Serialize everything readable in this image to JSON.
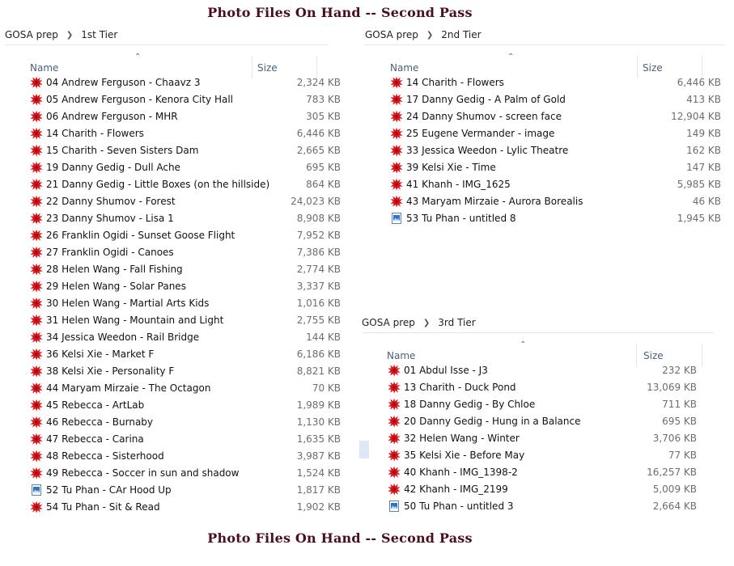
{
  "title": "Photo Files On Hand  --  Second Pass",
  "columns": {
    "name": "Name",
    "size": "Size"
  },
  "panels": [
    {
      "crumbs": [
        "GOSA prep",
        "1st Tier"
      ],
      "files": [
        {
          "name": "04 Andrew Ferguson - Chaavz 3",
          "size": "2,324 KB",
          "icon": "red-splat"
        },
        {
          "name": "05 Andrew Ferguson - Kenora City Hall",
          "size": "783 KB",
          "icon": "red-splat"
        },
        {
          "name": "06 Andrew Ferguson - MHR",
          "size": "305 KB",
          "icon": "red-splat"
        },
        {
          "name": "14 Charith - Flowers",
          "size": "6,446 KB",
          "icon": "red-splat"
        },
        {
          "name": "15 Charith - Seven Sisters Dam",
          "size": "2,665 KB",
          "icon": "red-splat"
        },
        {
          "name": "19 Danny Gedig - Dull Ache",
          "size": "695 KB",
          "icon": "red-splat"
        },
        {
          "name": "21 Danny Gedig - Little Boxes (on the hillside)",
          "size": "864 KB",
          "icon": "red-splat"
        },
        {
          "name": "22 Danny Shumov - Forest",
          "size": "24,023 KB",
          "icon": "red-splat"
        },
        {
          "name": "23 Danny Shumov - Lisa 1",
          "size": "8,908 KB",
          "icon": "red-splat"
        },
        {
          "name": "26 Franklin Ogidi - Sunset Goose Flight",
          "size": "7,952 KB",
          "icon": "red-splat"
        },
        {
          "name": "27 Franklin Ogidi - Canoes",
          "size": "7,386 KB",
          "icon": "red-splat"
        },
        {
          "name": "28 Helen Wang - Fall Fishing",
          "size": "2,774 KB",
          "icon": "red-splat"
        },
        {
          "name": "29 Helen Wang - Solar Panes",
          "size": "3,337 KB",
          "icon": "red-splat"
        },
        {
          "name": "30 Helen Wang - Martial Arts Kids",
          "size": "1,016 KB",
          "icon": "red-splat"
        },
        {
          "name": "31 Helen Wang - Mountain and Light",
          "size": "2,755 KB",
          "icon": "red-splat"
        },
        {
          "name": "34 Jessica Weedon - Rail Bridge",
          "size": "144 KB",
          "icon": "red-splat"
        },
        {
          "name": "36 Kelsi Xie - Market F",
          "size": "6,186 KB",
          "icon": "red-splat"
        },
        {
          "name": "38 Kelsi Xie - Personality F",
          "size": "8,821 KB",
          "icon": "red-splat"
        },
        {
          "name": "44 Maryam Mirzaie - The Octagon",
          "size": "70 KB",
          "icon": "red-splat"
        },
        {
          "name": "45 Rebecca - ArtLab",
          "size": "1,989 KB",
          "icon": "red-splat"
        },
        {
          "name": "46 Rebecca - Burnaby",
          "size": "1,130 KB",
          "icon": "red-splat"
        },
        {
          "name": "47 Rebecca - Carina",
          "size": "1,635 KB",
          "icon": "red-splat"
        },
        {
          "name": "48 Rebecca - Sisterhood",
          "size": "3,987 KB",
          "icon": "red-splat"
        },
        {
          "name": "49 Rebecca - Soccer in sun and shadow",
          "size": "1,524 KB",
          "icon": "red-splat"
        },
        {
          "name": "52 Tu Phan - CAr Hood Up",
          "size": "1,817 KB",
          "icon": "image-file"
        },
        {
          "name": "54 Tu Phan - Sit & Read",
          "size": "1,902 KB",
          "icon": "red-splat"
        }
      ]
    },
    {
      "crumbs": [
        "GOSA prep",
        "2nd Tier"
      ],
      "files": [
        {
          "name": "14 Charith - Flowers",
          "size": "6,446 KB",
          "icon": "red-splat"
        },
        {
          "name": "17 Danny Gedig - A Palm of Gold",
          "size": "413 KB",
          "icon": "red-splat"
        },
        {
          "name": "24 Danny Shumov - screen face",
          "size": "12,904 KB",
          "icon": "red-splat"
        },
        {
          "name": "25 Eugene Vermander - image",
          "size": "149 KB",
          "icon": "red-splat"
        },
        {
          "name": "33 Jessica Weedon - Lylic Theatre",
          "size": "162 KB",
          "icon": "red-splat"
        },
        {
          "name": "39 Kelsi Xie - Time",
          "size": "147 KB",
          "icon": "red-splat"
        },
        {
          "name": "41 Khanh - IMG_1625",
          "size": "5,985 KB",
          "icon": "red-splat"
        },
        {
          "name": "43 Maryam Mirzaie - Aurora Borealis",
          "size": "46 KB",
          "icon": "red-splat"
        },
        {
          "name": "53 Tu Phan - untitled 8",
          "size": "1,945 KB",
          "icon": "image-file"
        }
      ]
    },
    {
      "crumbs": [
        "GOSA prep",
        "3rd Tier"
      ],
      "files": [
        {
          "name": "01 Abdul Isse - J3",
          "size": "232 KB",
          "icon": "red-splat"
        },
        {
          "name": "13 Charith - Duck Pond",
          "size": "13,069 KB",
          "icon": "red-splat"
        },
        {
          "name": "18 Danny Gedig - By Chloe",
          "size": "711 KB",
          "icon": "red-splat"
        },
        {
          "name": "20 Danny Gedig - Hung in a Balance",
          "size": "695 KB",
          "icon": "red-splat"
        },
        {
          "name": "32 Helen Wang - Winter",
          "size": "3,706 KB",
          "icon": "red-splat"
        },
        {
          "name": "35 Kelsi Xie - Before May",
          "size": "77 KB",
          "icon": "red-splat"
        },
        {
          "name": "40 Khanh - IMG_1398-2",
          "size": "16,257 KB",
          "icon": "red-splat"
        },
        {
          "name": "42 Khanh - IMG_2199",
          "size": "5,009 KB",
          "icon": "red-splat"
        },
        {
          "name": "50 Tu Phan - untitled 3",
          "size": "2,664 KB",
          "icon": "image-file"
        }
      ]
    }
  ]
}
